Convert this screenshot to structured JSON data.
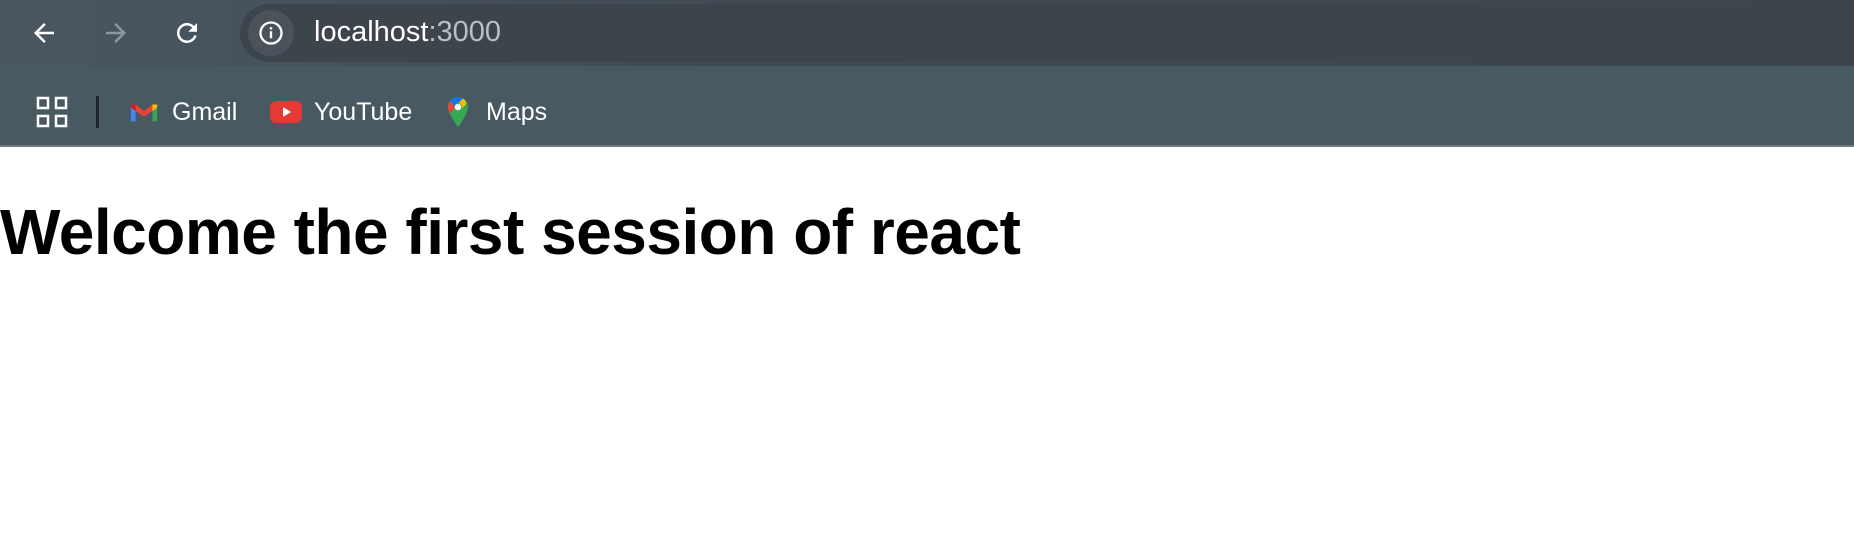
{
  "browser": {
    "address_bar": {
      "host": "localhost",
      "port": ":3000"
    },
    "nav": {
      "back_icon": "arrow-left-icon",
      "forward_icon": "arrow-right-icon",
      "reload_icon": "reload-icon",
      "site_info_icon": "info-icon"
    },
    "bookmarks": [
      {
        "label": "Gmail",
        "icon": "gmail-icon"
      },
      {
        "label": "YouTube",
        "icon": "youtube-icon"
      },
      {
        "label": "Maps",
        "icon": "maps-icon"
      }
    ],
    "colors": {
      "toolbar": "#3f4a53",
      "bookmarks_bar": "#495961",
      "text": "#ffffff",
      "youtube_red": "#e53935"
    }
  },
  "page": {
    "heading": "Welcome the first session of react"
  }
}
